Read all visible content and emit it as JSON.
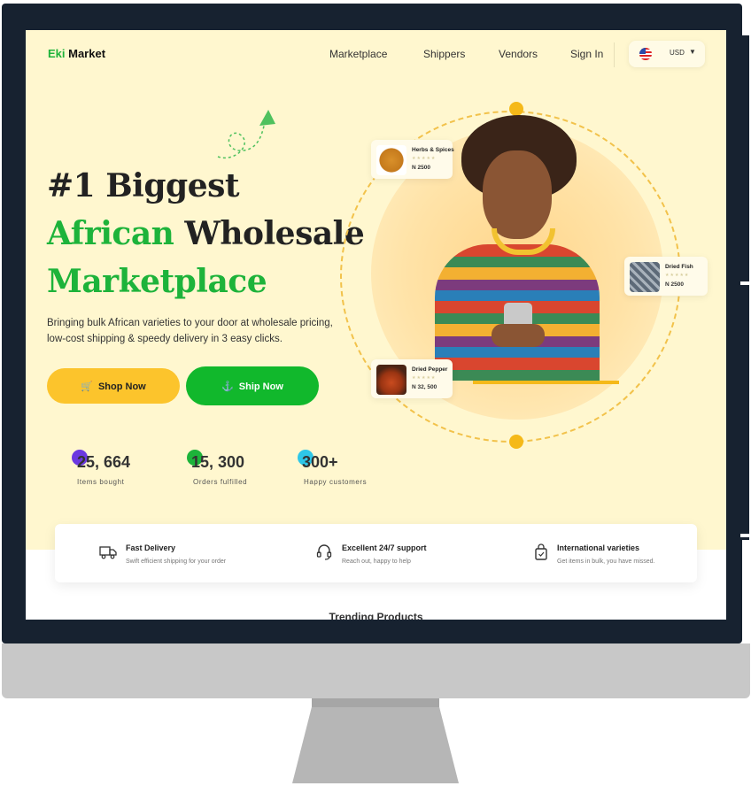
{
  "brand": {
    "logo_prefix": "Eki",
    "logo_suffix": " Market"
  },
  "nav": {
    "items": [
      "Marketplace",
      "Shippers",
      "Vendors",
      "Sign In"
    ],
    "currency": "USD",
    "currency_caret": "▼"
  },
  "hero": {
    "line1": "#1 Biggest",
    "line2_green": "African",
    "line2_dark": " Wholesale",
    "line3": "Marketplace",
    "subtitle": "Bringing bulk African varieties to your door at wholesale pricing, low-cost shipping & speedy delivery in 3 easy clicks.",
    "shop_button": "Shop Now",
    "ship_button": "Ship Now"
  },
  "stats": [
    {
      "value": "25, 664",
      "label": "Items bought",
      "color": "#6b39e0"
    },
    {
      "value": "15, 300",
      "label": "Orders fulfilled",
      "color": "#1db33a"
    },
    {
      "value": "300+",
      "label": "Happy customers",
      "color": "#2ec7e8"
    }
  ],
  "products": [
    {
      "name": "Herbs & Spices",
      "price": "N 2500",
      "stars": "★★★★★"
    },
    {
      "name": "Dried Fish",
      "price": "N 2500",
      "stars": "★★★★★"
    },
    {
      "name": "Dried Pepper",
      "price": "N 32, 500",
      "stars": "★★★★★"
    }
  ],
  "features": [
    {
      "icon": "truck-icon",
      "title": "Fast Delivery",
      "desc": "Swift efficient shipping for your order"
    },
    {
      "icon": "headset-icon",
      "title": "Excellent 24/7 support",
      "desc": "Reach out, happy to help"
    },
    {
      "icon": "bag-icon",
      "title": "International varieties",
      "desc": "Get items in bulk, you have missed."
    }
  ],
  "trending_title": "Trending Products",
  "colors": {
    "accent_green": "#1db33a",
    "accent_yellow": "#fcc42c",
    "bg_cream": "#fff7cf",
    "bezel": "#172230"
  }
}
